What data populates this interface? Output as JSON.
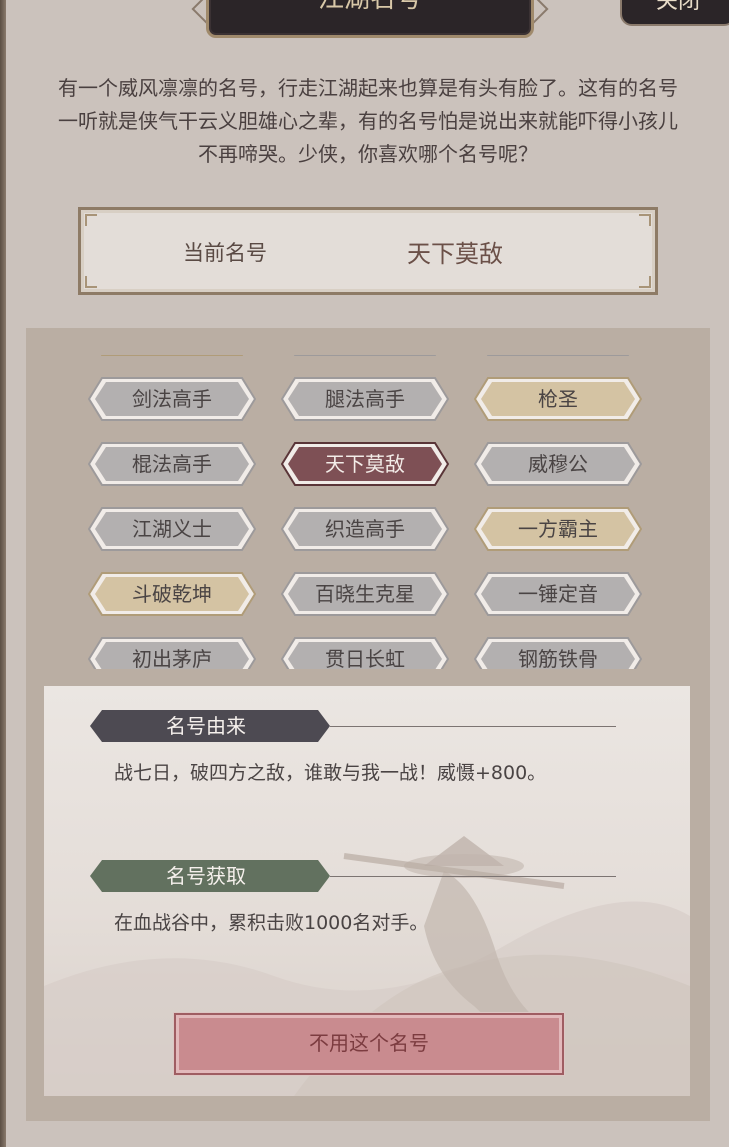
{
  "title": "江湖名号",
  "close_label": "关闭",
  "intro": "有一个威风凛凛的名号，行走江湖起来也算是有头有脸了。这有的名号一听就是侠气干云义胆雄心之辈，有的名号怕是说出来就能吓得小孩儿不再啼哭。少侠，你喜欢哪个名号呢？",
  "current": {
    "label": "当前名号",
    "value": "天下莫敌"
  },
  "titles": [
    {
      "label": "剑法高手",
      "style": "gray"
    },
    {
      "label": "腿法高手",
      "style": "gray"
    },
    {
      "label": "枪圣",
      "style": "gold"
    },
    {
      "label": "棍法高手",
      "style": "gray"
    },
    {
      "label": "天下莫敌",
      "style": "selected"
    },
    {
      "label": "威穆公",
      "style": "gray"
    },
    {
      "label": "江湖义士",
      "style": "gray"
    },
    {
      "label": "织造高手",
      "style": "gray"
    },
    {
      "label": "一方霸主",
      "style": "gold"
    },
    {
      "label": "斗破乾坤",
      "style": "gold"
    },
    {
      "label": "百晓生克星",
      "style": "gray"
    },
    {
      "label": "一锤定音",
      "style": "gray"
    },
    {
      "label": "初出茅庐",
      "style": "gray"
    },
    {
      "label": "贯日长虹",
      "style": "gray"
    },
    {
      "label": "钢筋铁骨",
      "style": "gray"
    }
  ],
  "origin": {
    "heading": "名号由来",
    "text": "战七日，破四方之敌，谁敢与我一战！威慑+800。"
  },
  "acquire": {
    "heading": "名号获取",
    "text": "在血战谷中，累积击败1000名对手。"
  },
  "action_label": "不用这个名号",
  "colors": {
    "gray_fill": "#b3b0b0",
    "gold_fill": "#d4c3a3",
    "selected_fill": "#7e5055",
    "origin_ribbon": "#4d4a52",
    "acquire_ribbon": "#62715f",
    "button_fill": "#c98b8f"
  }
}
